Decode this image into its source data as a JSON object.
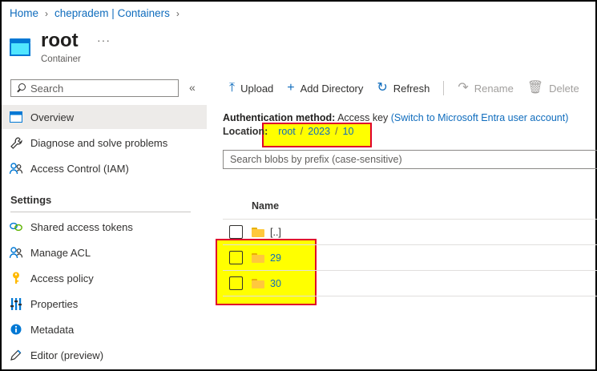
{
  "breadcrumb": {
    "home": "Home",
    "account": "chepradem | Containers"
  },
  "header": {
    "title": "root",
    "subtitle": "Container",
    "more": "···"
  },
  "sidebar": {
    "search_placeholder": "Search",
    "collapse": "«",
    "items": [
      {
        "label": "Overview",
        "icon": "overview-icon"
      },
      {
        "label": "Diagnose and solve problems",
        "icon": "wrench-icon"
      },
      {
        "label": "Access Control (IAM)",
        "icon": "people-icon"
      }
    ],
    "settings_label": "Settings",
    "settings_items": [
      {
        "label": "Shared access tokens",
        "icon": "link-icon"
      },
      {
        "label": "Manage ACL",
        "icon": "people-icon"
      },
      {
        "label": "Access policy",
        "icon": "key-icon"
      },
      {
        "label": "Properties",
        "icon": "properties-icon"
      },
      {
        "label": "Metadata",
        "icon": "info-icon"
      },
      {
        "label": "Editor (preview)",
        "icon": "pencil-icon"
      }
    ]
  },
  "toolbar": {
    "upload": "Upload",
    "add_directory": "Add Directory",
    "refresh": "Refresh",
    "rename": "Rename",
    "delete": "Delete"
  },
  "main": {
    "auth_label": "Authentication method:",
    "auth_value": "Access key",
    "auth_link": "(Switch to Microsoft Entra user account)",
    "location_label": "Location:",
    "location_path": [
      "root",
      "2023",
      "10"
    ],
    "prefix_placeholder": "Search blobs by prefix (case-sensitive)",
    "column_name": "Name",
    "rows": [
      {
        "name": "[..]"
      },
      {
        "name": "29"
      },
      {
        "name": "30"
      }
    ]
  },
  "colors": {
    "accent": "#0f6cbd",
    "highlight": "#ffff00",
    "highlight_border": "#e0002a",
    "folder": "#ffc83d"
  }
}
